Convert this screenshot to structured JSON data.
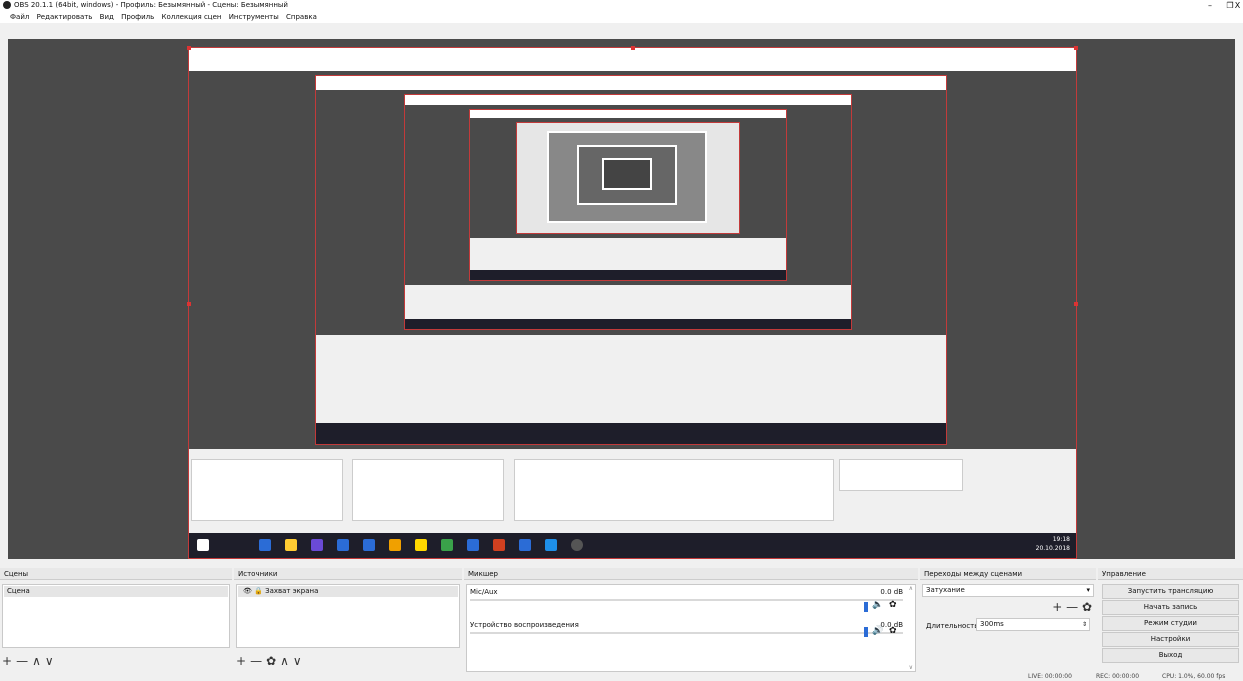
{
  "window": {
    "title": "OBS 20.1.1 (64bit, windows) - Профиль: Безымянный - Сцены: Безымянный",
    "minimize_glyph": "–",
    "maximize_glyph": "❐",
    "close_glyph": "X"
  },
  "menu": [
    "Файл",
    "Редактировать",
    "Вид",
    "Профиль",
    "Коллекция сцен",
    "Инструменты",
    "Справка"
  ],
  "scenes": {
    "header": "Сцены",
    "items": [
      "Сцена"
    ]
  },
  "sources": {
    "header": "Источники",
    "items": [
      "Захват экрана"
    ]
  },
  "mixer": {
    "header": "Микшер",
    "channels": [
      {
        "name": "Mic/Aux",
        "level": "0.0 dB",
        "muted": true
      },
      {
        "name": "Устройство воспроизведения",
        "level": "0.0 dB",
        "muted": false
      }
    ]
  },
  "transitions": {
    "header": "Переходы между сценами",
    "selected": "Затухание",
    "duration_label": "Длительность",
    "duration_value": "300ms"
  },
  "controls": {
    "header": "Управление",
    "buttons": [
      "Запустить трансляцию",
      "Начать запись",
      "Режим студии",
      "Настройки",
      "Выход"
    ]
  },
  "status": {
    "live": "LIVE: 00:00:00",
    "rec": "REC: 00:00:00",
    "cpu": "CPU: 1.0%, 60.00 fps"
  },
  "nested_clock": {
    "time": "19:18",
    "date": "20.10.2018"
  },
  "toolbar_glyphs": {
    "add": "+",
    "remove": "—",
    "up": "∧",
    "down": "∨",
    "gear": "✿"
  },
  "colors": {
    "preview_bg": "#4a4a4a",
    "selection_red": "#c23a3a",
    "meter_blue": "#2b6cd6",
    "mute_red": "#d33"
  }
}
